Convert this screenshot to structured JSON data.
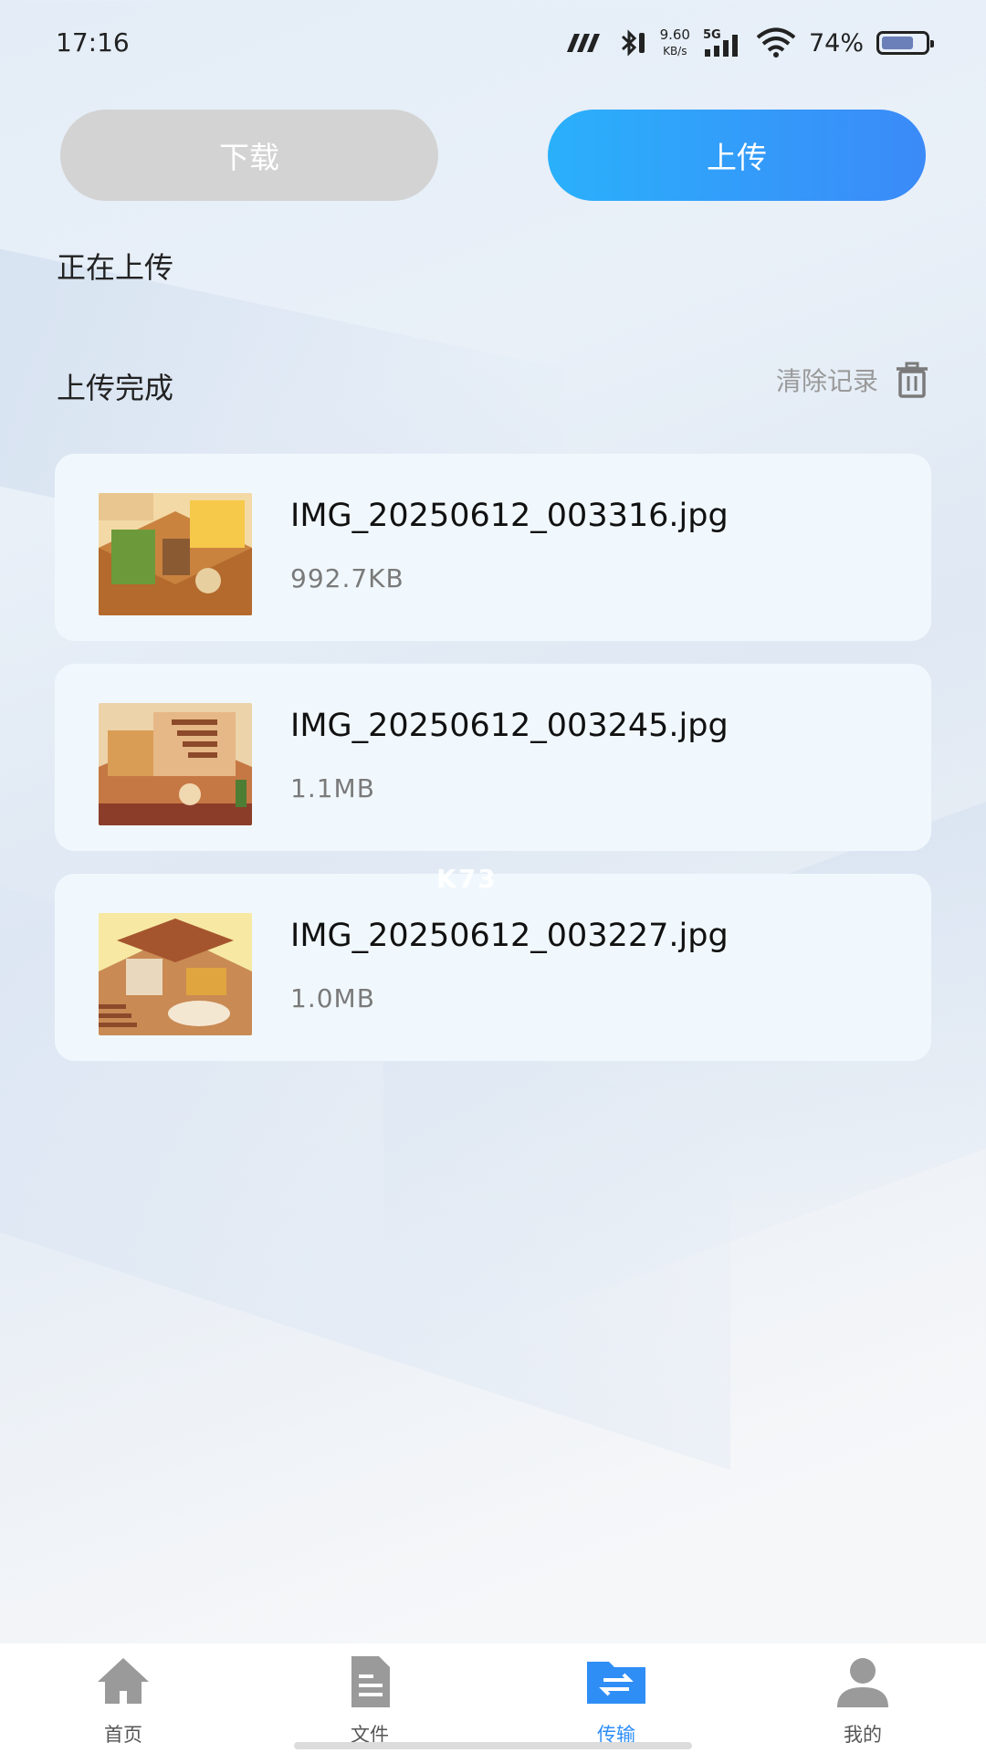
{
  "status_bar": {
    "time": "17:16",
    "speed_value": "9.60",
    "speed_unit": "KB/s",
    "network": "5G",
    "battery": "74%"
  },
  "tabs": {
    "download": "下载",
    "upload": "上传"
  },
  "sections": {
    "uploading_title": "正在上传",
    "done_title": "上传完成",
    "clear_records": "清除记录"
  },
  "files": [
    {
      "name": "IMG_20250612_003316.jpg",
      "size": "992.7KB"
    },
    {
      "name": "IMG_20250612_003245.jpg",
      "size": "1.1MB"
    },
    {
      "name": "IMG_20250612_003227.jpg",
      "size": "1.0MB"
    }
  ],
  "watermark": "K73",
  "nav": [
    {
      "label": "首页",
      "icon": "home-icon"
    },
    {
      "label": "文件",
      "icon": "file-icon"
    },
    {
      "label": "传输",
      "icon": "transfer-icon"
    },
    {
      "label": "我的",
      "icon": "user-icon"
    }
  ],
  "colors": {
    "accent": "#2f8ef6",
    "upload_gradient_start": "#2ab0fb",
    "upload_gradient_end": "#3b8af8",
    "inactive_tab": "#d3d3d3",
    "card_bg": "#f1f8fd"
  }
}
